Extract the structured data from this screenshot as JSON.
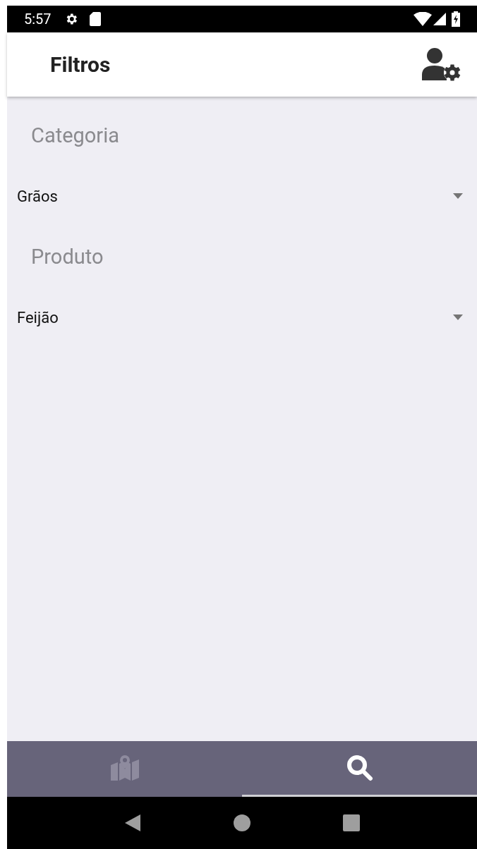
{
  "status_bar": {
    "time": "5:57"
  },
  "app_bar": {
    "title": "Filtros"
  },
  "filters": [
    {
      "label": "Categoria",
      "value": "Grãos"
    },
    {
      "label": "Produto",
      "value": "Feijão"
    }
  ],
  "tabs": [
    {
      "kind": "map",
      "selected": false
    },
    {
      "kind": "search",
      "selected": true
    }
  ]
}
